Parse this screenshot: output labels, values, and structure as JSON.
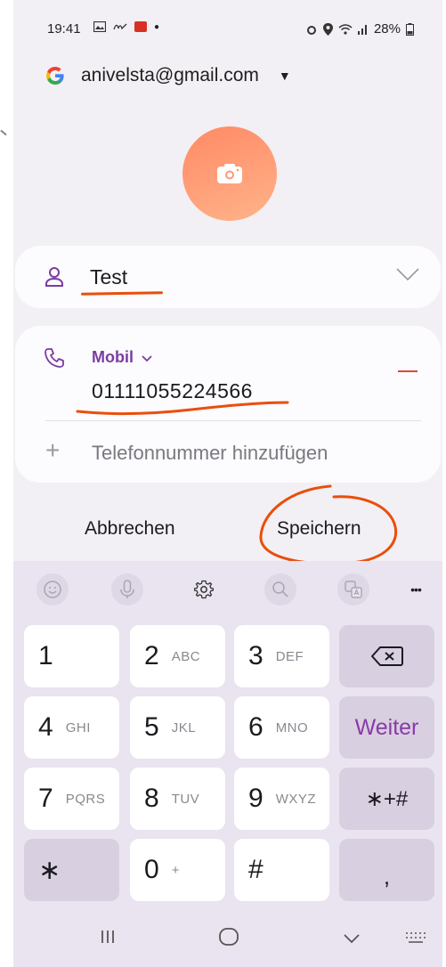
{
  "status": {
    "time": "19:41",
    "battery": "28%"
  },
  "account": {
    "email": "anivelsta@gmail.com"
  },
  "contact": {
    "name": "Test",
    "phone_label": "Mobil",
    "phone_number": "01111055224566",
    "add_phone": "Telefonnummer hinzufügen"
  },
  "actions": {
    "cancel": "Abbrechen",
    "save": "Speichern"
  },
  "keyboard": {
    "keys": [
      {
        "num": "1",
        "letters": ""
      },
      {
        "num": "2",
        "letters": "ABC"
      },
      {
        "num": "3",
        "letters": "DEF"
      },
      {
        "num": "4",
        "letters": "GHI"
      },
      {
        "num": "5",
        "letters": "JKL"
      },
      {
        "num": "6",
        "letters": "MNO"
      },
      {
        "num": "7",
        "letters": "PQRS"
      },
      {
        "num": "8",
        "letters": "TUV"
      },
      {
        "num": "9",
        "letters": "WXYZ"
      },
      {
        "num": "0",
        "letters": "+"
      }
    ],
    "weiter": "Weiter",
    "star_plus_hash": "∗+#",
    "star": "∗",
    "hash": "#",
    "comma": ",",
    "more": "•••"
  },
  "colors": {
    "accent_purple": "#7b3ca0",
    "annotation_orange": "#ea4e0c",
    "avatar_gradient": [
      "#ff8a65",
      "#ffb38a"
    ]
  }
}
